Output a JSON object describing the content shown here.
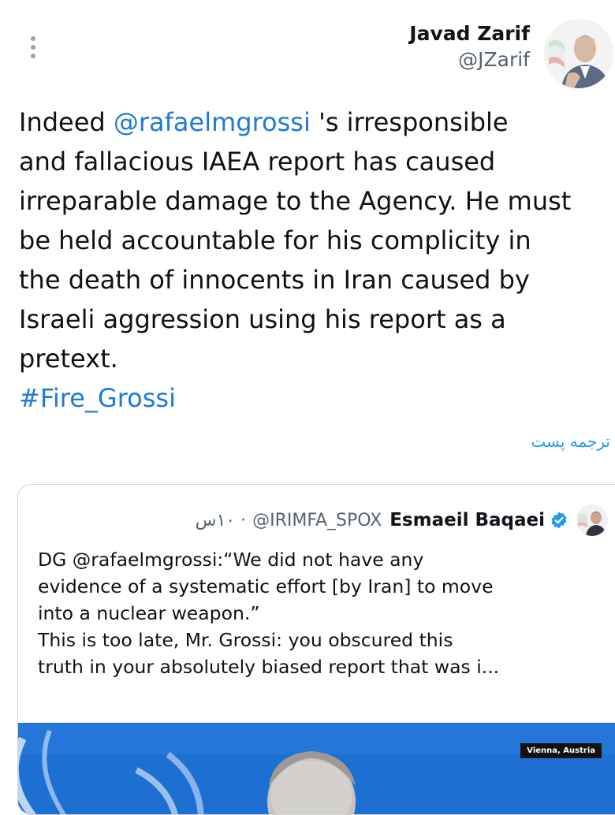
{
  "tweet": {
    "author_name": "Javad Zarif",
    "author_handle": "@JZarif",
    "text_lines": [
      [
        {
          "t": "Indeed "
        },
        {
          "t": "@rafaelmgrossi",
          "link": true
        },
        {
          "t": " 's irresponsible"
        }
      ],
      [
        {
          "t": "and fallacious IAEA report has caused"
        }
      ],
      [
        {
          "t": "irreparable damage to the Agency. He must"
        }
      ],
      [
        {
          "t": "be held accountable for his complicity in"
        }
      ],
      [
        {
          "t": "the death of innocents in Iran caused by"
        }
      ],
      [
        {
          "t": "Israeli aggression using his report as a"
        }
      ],
      [
        {
          "t": "pretext."
        }
      ],
      [
        {
          "t": "#Fire_Grossi",
          "link": true
        }
      ]
    ],
    "translate_label": "ترجمه پست"
  },
  "quote": {
    "author_name": "Esmaeil Baqaei",
    "author_handle": "@IRIMFA_SPOX",
    "time": "· ۱۰س",
    "text_lines": [
      "DG @rafaelmgrossi:“We did not have any",
      "evidence of a systematic effort [by Iran] to move",
      "into a nuclear weapon.”",
      "This is too late, Mr. Grossi: you obscured this",
      "truth in your absolutely biased report that was i..."
    ],
    "media_caption": "Vienna, Austria"
  },
  "colors": {
    "link": "#1d7bd8",
    "verified": "#1d9bf0",
    "media_bg": "#1e6fd2"
  },
  "icons": {
    "more": "more-vertical-icon",
    "verified": "verified-badge-icon"
  }
}
